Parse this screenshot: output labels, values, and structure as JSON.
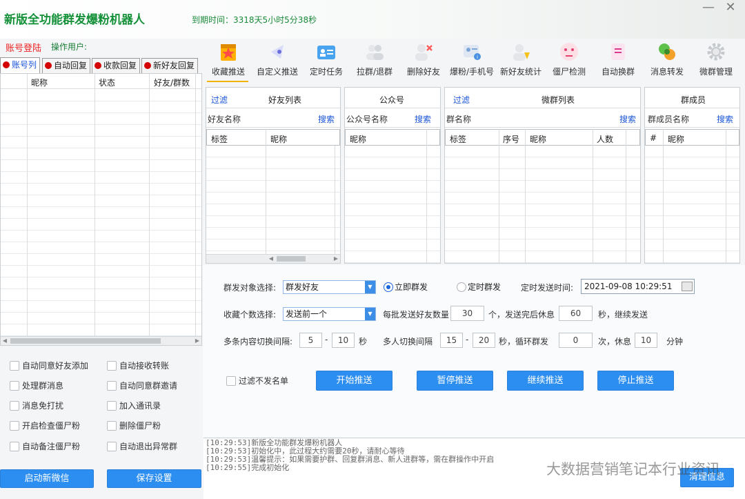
{
  "app": {
    "title": "新版全功能群发爆粉机器人",
    "expiry": "到期时间：3318天5小时5分38秒",
    "minimize": "—",
    "close": "✕"
  },
  "account": {
    "login_label": "账号登陆",
    "operator_label": "操作用户:"
  },
  "left_tabs": [
    "账号列",
    "自动回复",
    "收款回复",
    "新好友回复"
  ],
  "account_table": {
    "columns": [
      "昵称",
      "状态",
      "好友/群数"
    ]
  },
  "left_options": [
    "自动同意好友添加",
    "自动接收转账",
    "处理群消息",
    "自动同意群邀请",
    "消息免打扰",
    "加入通讯录",
    "开启检查僵尸粉",
    "删除僵尸粉",
    "自动备注僵尸粉",
    "自动退出异常群"
  ],
  "left_buttons": {
    "start_wechat": "启动新微信",
    "save_settings": "保存设置"
  },
  "toolbar": [
    {
      "label": "收藏推送",
      "icon": "star-folder-icon"
    },
    {
      "label": "自定义推送",
      "icon": "send-icon"
    },
    {
      "label": "定时任务",
      "icon": "id-card-icon"
    },
    {
      "label": "拉群/退群",
      "icon": "group-icon"
    },
    {
      "label": "删除好友",
      "icon": "remove-user-icon"
    },
    {
      "label": "爆粉/手机号",
      "icon": "contact-info-icon"
    },
    {
      "label": "新好友统计",
      "icon": "new-user-icon"
    },
    {
      "label": "僵尸检测",
      "icon": "zombie-face-icon"
    },
    {
      "label": "自动换群",
      "icon": "switch-group-icon"
    },
    {
      "label": "消息转发",
      "icon": "forward-icon"
    },
    {
      "label": "微群管理",
      "icon": "gear-icon"
    }
  ],
  "panels": {
    "friends": {
      "filter": "过滤",
      "title": "好友列表",
      "name_label": "好友名称",
      "search": "搜索",
      "columns": [
        "标签",
        "昵称"
      ]
    },
    "official": {
      "title": "公众号",
      "name_label": "公众号名称",
      "search": "搜索",
      "columns": [
        "昵称"
      ]
    },
    "groups": {
      "filter": "过滤",
      "title": "微群列表",
      "name_label": "群名称",
      "search": "搜索",
      "columns": [
        "标签",
        "序号",
        "昵称",
        "人数"
      ]
    },
    "members": {
      "title": "群成员",
      "name_label": "群成员名称",
      "search": "搜索",
      "columns": [
        "#",
        "昵称"
      ]
    }
  },
  "form": {
    "target_label": "群发对象选择:",
    "target_value": "群发好友",
    "radio_now": "立即群发",
    "radio_timed": "定时群发",
    "timed_label": "定时发送时间:",
    "timed_value": "2021-09-08 10:29:51",
    "fav_label": "收藏个数选择:",
    "fav_value": "发送前一个",
    "batch_label": "每批发送好友数量",
    "batch_value": "30",
    "rest_prefix": "个，发送完后休息",
    "rest_value": "60",
    "rest_suffix": "秒，继续发送",
    "interval_label": "多条内容切换间隔:",
    "interval_min": "5",
    "interval_sep": "-",
    "interval_max": "10",
    "interval_unit": "秒",
    "multi_label": "多人切换间隔",
    "multi_min": "15",
    "multi_sep": "-",
    "multi_max": "20",
    "loop_label": "秒，循环群发",
    "loop_value": "0",
    "loop_unit": "次，休息",
    "break_value": "10",
    "break_unit": "分钟",
    "blacklist_label": "过滤不发名单",
    "btn_start": "开始推送",
    "btn_pause": "暂停推送",
    "btn_continue": "继续推送",
    "btn_stop": "停止推送"
  },
  "log": {
    "lines": [
      "[10:29:53]新版全功能群发爆粉机器人",
      "[10:29:53]初始化中，此过程大约需要20秒，请耐心等待",
      "[10:29:53]温馨提示：如果需要护群、回复群消息、新人进群等，需在群操作中开启",
      "[10:29:55]完成初始化"
    ],
    "clear_button": "清理信息"
  },
  "watermark": "大数据营销笔记本行业资讯"
}
